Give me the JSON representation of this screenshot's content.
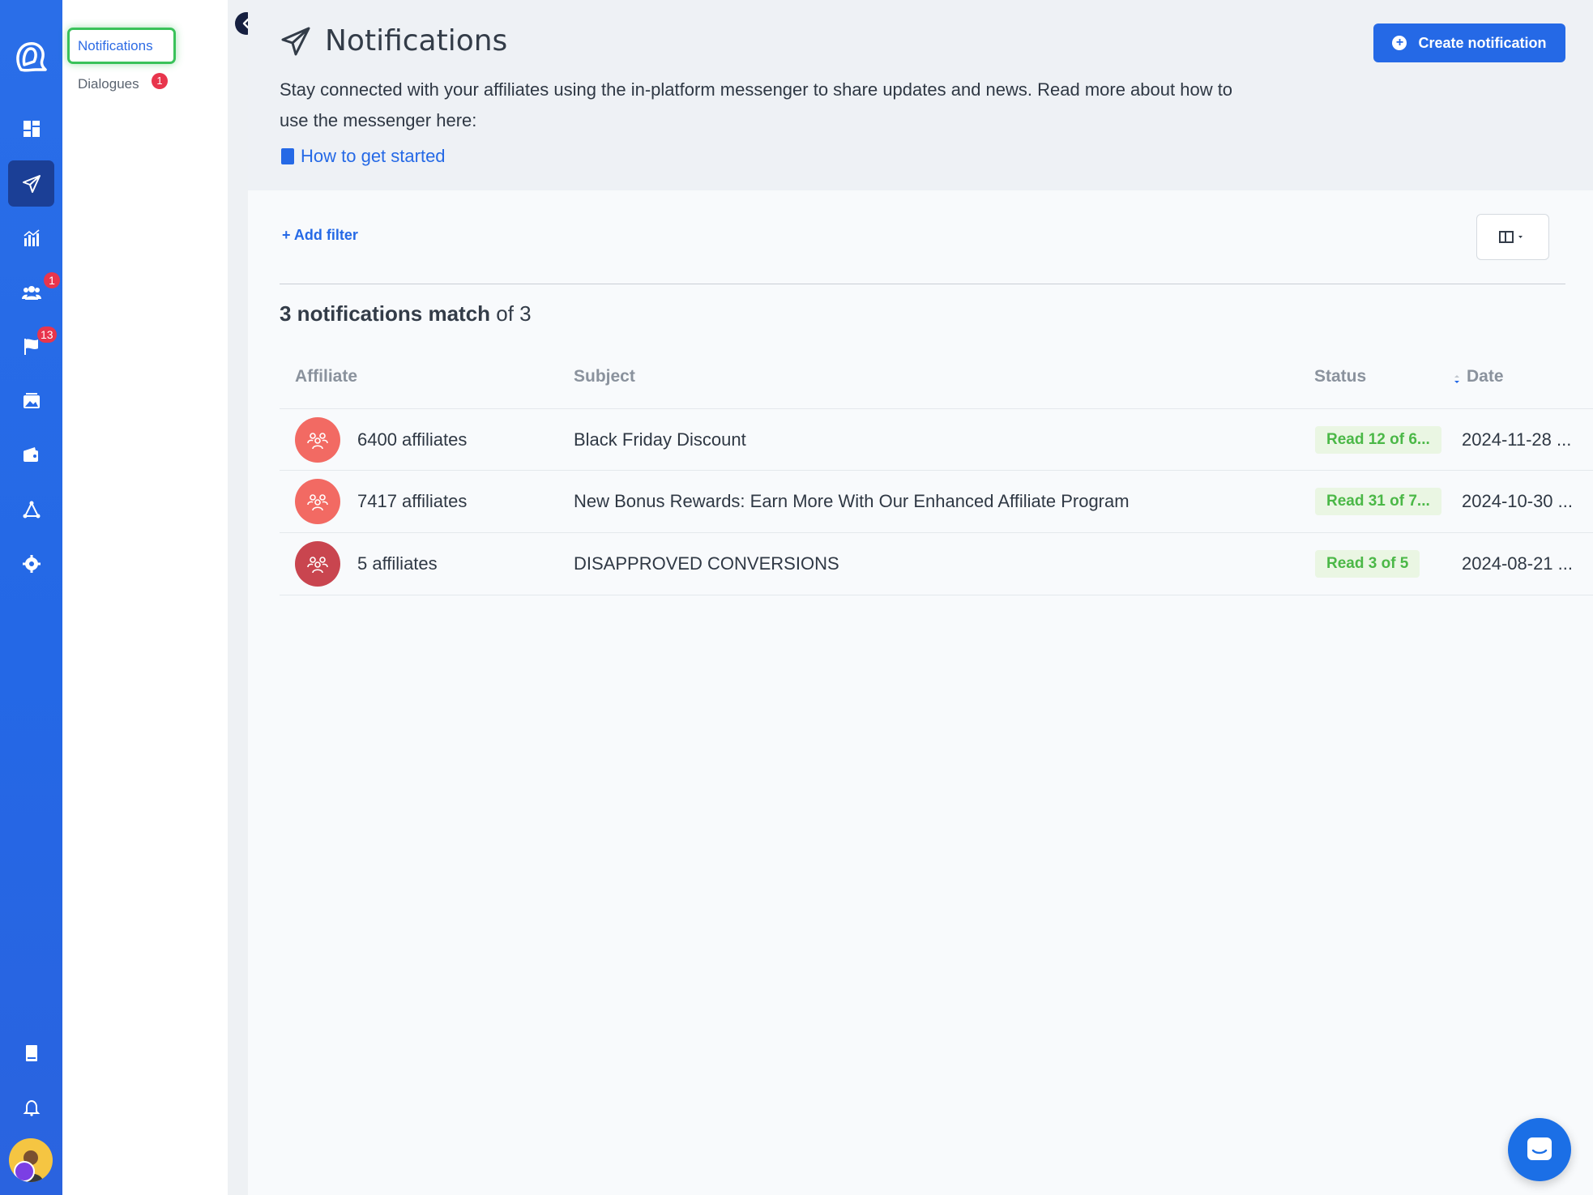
{
  "sidebar": {
    "badges": {
      "affiliates": "1",
      "flags": "13"
    }
  },
  "subnav": {
    "items": [
      {
        "label": "Notifications"
      },
      {
        "label": "Dialogues",
        "badge": "1"
      }
    ]
  },
  "header": {
    "title": "Notifications",
    "create_label": "Create notification",
    "description": "Stay connected with your affiliates using the in-platform messenger to share updates and news. Read more about how to use the messenger here:",
    "guide_link": "How to get started"
  },
  "toolbar": {
    "add_filter": "Add filter"
  },
  "summary": {
    "count_bold": "3 notifications match",
    "count_rest": " of 3"
  },
  "table": {
    "columns": {
      "affiliate": "Affiliate",
      "subject": "Subject",
      "status": "Status",
      "date": "Date"
    },
    "rows": [
      {
        "affiliate": "6400 affiliates",
        "subject": "Black Friday Discount",
        "status": "Read 12 of 6...",
        "date": "2024-11-28 ...",
        "avatar_color": "#f26a63"
      },
      {
        "affiliate": "7417 affiliates",
        "subject": "New Bonus Rewards: Earn More With Our Enhanced Affiliate Program",
        "status": "Read 31 of 7...",
        "date": "2024-10-30 ...",
        "avatar_color": "#f26a63"
      },
      {
        "affiliate": "5 affiliates",
        "subject": "DISAPPROVED CONVERSIONS",
        "status": "Read 3 of 5",
        "date": "2024-08-21 ...",
        "avatar_color": "#c9454f"
      }
    ]
  },
  "colors": {
    "accent": "#2569e6",
    "rail": "#2468e6",
    "status_text": "#4bb847"
  }
}
